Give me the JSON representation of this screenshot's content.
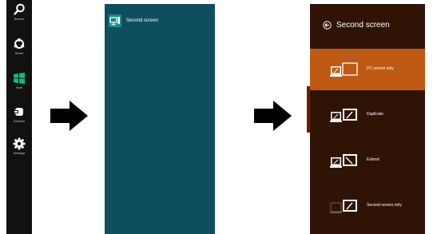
{
  "charms": [
    {
      "label": "Search",
      "icon": "search-icon"
    },
    {
      "label": "Share",
      "icon": "share-icon"
    },
    {
      "label": "Start",
      "icon": "windows-start-icon",
      "color": "#00c47a"
    },
    {
      "label": "Devices",
      "icon": "devices-icon"
    },
    {
      "label": "Settings",
      "icon": "gear-icon"
    }
  ],
  "devices": {
    "items": [
      {
        "label": "Second screen",
        "icon": "second-screen-icon"
      }
    ]
  },
  "second_screen": {
    "title": "Second screen",
    "options": [
      {
        "label": "PC screen only",
        "selected": true,
        "icon": "pc-screen-only-icon"
      },
      {
        "label": "Duplicate",
        "selected": false,
        "icon": "duplicate-icon"
      },
      {
        "label": "Extend",
        "selected": false,
        "icon": "extend-icon"
      },
      {
        "label": "Second screen only",
        "selected": false,
        "icon": "second-screen-only-icon"
      }
    ]
  },
  "colors": {
    "charms_bg": "#111111",
    "devices_bg": "#0f4e5f",
    "second_screen_bg": "#2f1406",
    "selected_option": "#bf5a14",
    "arrow": "#000000"
  }
}
